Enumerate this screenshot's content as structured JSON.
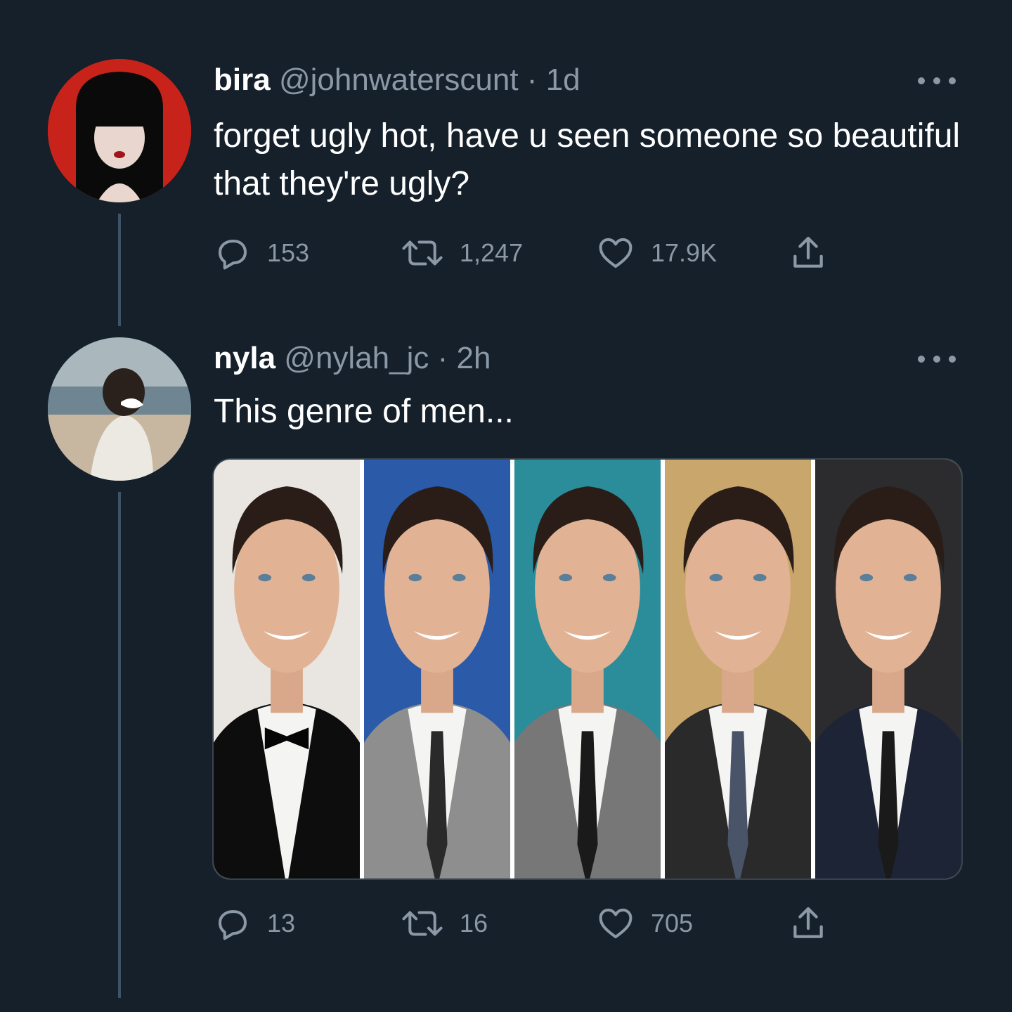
{
  "tweets": [
    {
      "display_name": "bira",
      "handle": "@johnwaterscunt",
      "separator": "·",
      "time": "1d",
      "text": "forget ugly hot, have u seen someone so beautiful that they're ugly?",
      "replies": "153",
      "retweets": "1,247",
      "likes": "17.9K"
    },
    {
      "display_name": "nyla",
      "handle": "@nylah_jc",
      "separator": "·",
      "time": "2h",
      "text": "This genre of men...",
      "replies": "13",
      "retweets": "16",
      "likes": "705",
      "photos": [
        {
          "bg": "#e9e6e2",
          "suit": "#0d0d0d",
          "tie": "bowtie"
        },
        {
          "bg": "#2a5aa8",
          "suit": "#8e8e8e",
          "tie": "dotted"
        },
        {
          "bg": "#2b8c9a",
          "suit": "#777777",
          "tie": "narrow"
        },
        {
          "bg": "#c9a66b",
          "suit": "#2a2a2a",
          "tie": "striped"
        },
        {
          "bg": "#2c2c2e",
          "suit": "#1d2435",
          "tie": "solid"
        }
      ]
    }
  ],
  "icons": [
    "reply-icon",
    "retweet-icon",
    "like-icon",
    "share-icon",
    "more-icon"
  ],
  "colors": {
    "background": "#15202b",
    "secondary_text": "#8b98a5",
    "thread_line": "#3d5466"
  }
}
